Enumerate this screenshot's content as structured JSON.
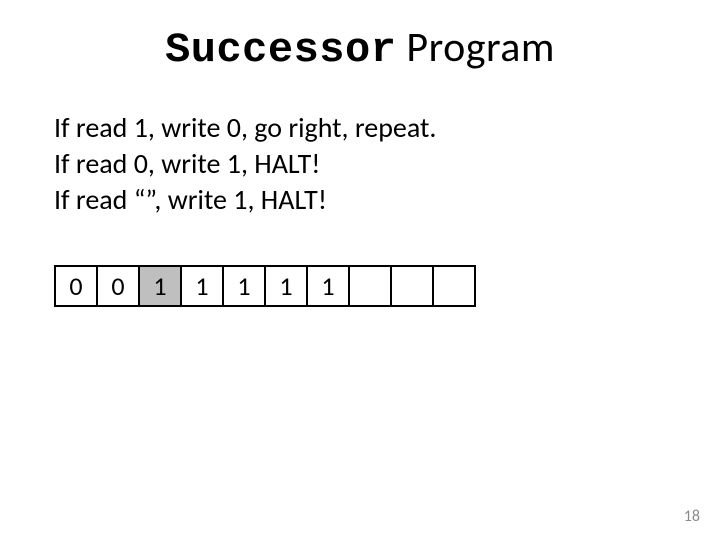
{
  "title": {
    "program_name": "Successor",
    "suffix": " Program"
  },
  "rules": {
    "line1": "If read 1, write 0, go right, repeat.",
    "line2": "If read 0, write 1, HALT!",
    "line3": "If read “”, write 1, HALT!"
  },
  "tape": {
    "cells": [
      "0",
      "0",
      "1",
      "1",
      "1",
      "1",
      "1",
      "",
      "",
      ""
    ],
    "highlight_index": 2
  },
  "page_number": "18"
}
